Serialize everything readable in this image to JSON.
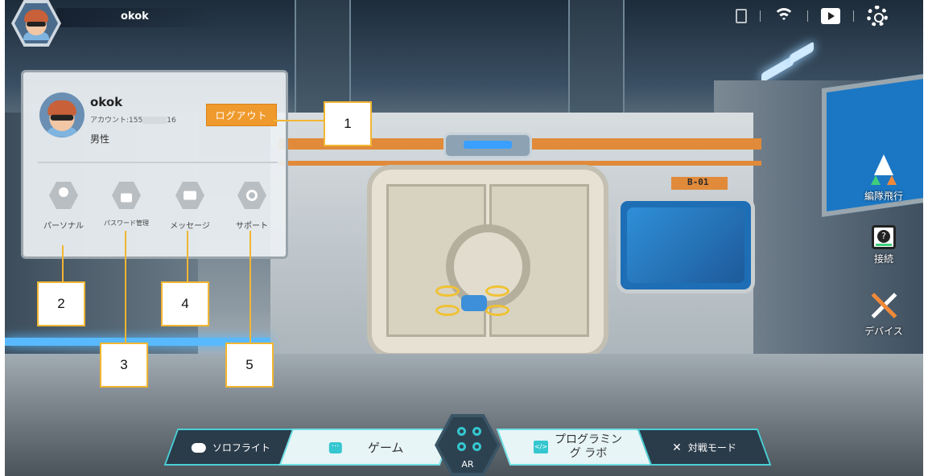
{
  "topbar": {
    "username": "okok",
    "icons": [
      "device-icon",
      "wifi-icon",
      "play-icon",
      "settings-icon"
    ]
  },
  "profile": {
    "name": "okok",
    "account_prefix": "アカウント:155",
    "account_suffix": "16",
    "gender": "男性",
    "logout_label": "ログアウト",
    "menu": [
      {
        "label": "パーソナル",
        "icon": "person-icon"
      },
      {
        "label": "パスワード管理",
        "icon": "lock-icon"
      },
      {
        "label": "メッセージ",
        "icon": "mail-icon"
      },
      {
        "label": "サポート",
        "icon": "headset-icon"
      }
    ]
  },
  "callouts": [
    "1",
    "2",
    "3",
    "4",
    "5"
  ],
  "side": {
    "formation": "編隊飛行",
    "connect": "接続",
    "device": "デバイス"
  },
  "bottom_nav": {
    "solo": "ソロフライト",
    "game": "ゲーム",
    "ar": "AR",
    "prog_line1": "プログラミン",
    "prog_line2": "グ ラボ",
    "battle": "対戦モード"
  },
  "scene": {
    "sign": "B-01",
    "accent": "#e08a3a"
  }
}
